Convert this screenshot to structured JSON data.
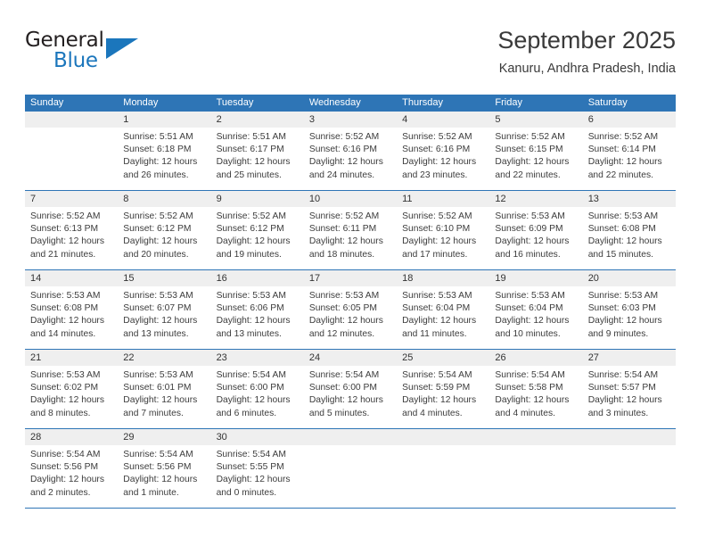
{
  "brand": {
    "word1": "General",
    "word2": "Blue",
    "accent_color": "#1b76bc"
  },
  "header": {
    "title": "September 2025",
    "subtitle": "Kanuru, Andhra Pradesh, India"
  },
  "theme": {
    "header_blue": "#2e75b6",
    "daynum_gray": "#efefef",
    "text": "#3c3c3c"
  },
  "weekdays": [
    "Sunday",
    "Monday",
    "Tuesday",
    "Wednesday",
    "Thursday",
    "Friday",
    "Saturday"
  ],
  "weeks": [
    [
      {
        "day": "",
        "lines": []
      },
      {
        "day": "1",
        "lines": [
          "Sunrise: 5:51 AM",
          "Sunset: 6:18 PM",
          "Daylight: 12 hours",
          "and 26 minutes."
        ]
      },
      {
        "day": "2",
        "lines": [
          "Sunrise: 5:51 AM",
          "Sunset: 6:17 PM",
          "Daylight: 12 hours",
          "and 25 minutes."
        ]
      },
      {
        "day": "3",
        "lines": [
          "Sunrise: 5:52 AM",
          "Sunset: 6:16 PM",
          "Daylight: 12 hours",
          "and 24 minutes."
        ]
      },
      {
        "day": "4",
        "lines": [
          "Sunrise: 5:52 AM",
          "Sunset: 6:16 PM",
          "Daylight: 12 hours",
          "and 23 minutes."
        ]
      },
      {
        "day": "5",
        "lines": [
          "Sunrise: 5:52 AM",
          "Sunset: 6:15 PM",
          "Daylight: 12 hours",
          "and 22 minutes."
        ]
      },
      {
        "day": "6",
        "lines": [
          "Sunrise: 5:52 AM",
          "Sunset: 6:14 PM",
          "Daylight: 12 hours",
          "and 22 minutes."
        ]
      }
    ],
    [
      {
        "day": "7",
        "lines": [
          "Sunrise: 5:52 AM",
          "Sunset: 6:13 PM",
          "Daylight: 12 hours",
          "and 21 minutes."
        ]
      },
      {
        "day": "8",
        "lines": [
          "Sunrise: 5:52 AM",
          "Sunset: 6:12 PM",
          "Daylight: 12 hours",
          "and 20 minutes."
        ]
      },
      {
        "day": "9",
        "lines": [
          "Sunrise: 5:52 AM",
          "Sunset: 6:12 PM",
          "Daylight: 12 hours",
          "and 19 minutes."
        ]
      },
      {
        "day": "10",
        "lines": [
          "Sunrise: 5:52 AM",
          "Sunset: 6:11 PM",
          "Daylight: 12 hours",
          "and 18 minutes."
        ]
      },
      {
        "day": "11",
        "lines": [
          "Sunrise: 5:52 AM",
          "Sunset: 6:10 PM",
          "Daylight: 12 hours",
          "and 17 minutes."
        ]
      },
      {
        "day": "12",
        "lines": [
          "Sunrise: 5:53 AM",
          "Sunset: 6:09 PM",
          "Daylight: 12 hours",
          "and 16 minutes."
        ]
      },
      {
        "day": "13",
        "lines": [
          "Sunrise: 5:53 AM",
          "Sunset: 6:08 PM",
          "Daylight: 12 hours",
          "and 15 minutes."
        ]
      }
    ],
    [
      {
        "day": "14",
        "lines": [
          "Sunrise: 5:53 AM",
          "Sunset: 6:08 PM",
          "Daylight: 12 hours",
          "and 14 minutes."
        ]
      },
      {
        "day": "15",
        "lines": [
          "Sunrise: 5:53 AM",
          "Sunset: 6:07 PM",
          "Daylight: 12 hours",
          "and 13 minutes."
        ]
      },
      {
        "day": "16",
        "lines": [
          "Sunrise: 5:53 AM",
          "Sunset: 6:06 PM",
          "Daylight: 12 hours",
          "and 13 minutes."
        ]
      },
      {
        "day": "17",
        "lines": [
          "Sunrise: 5:53 AM",
          "Sunset: 6:05 PM",
          "Daylight: 12 hours",
          "and 12 minutes."
        ]
      },
      {
        "day": "18",
        "lines": [
          "Sunrise: 5:53 AM",
          "Sunset: 6:04 PM",
          "Daylight: 12 hours",
          "and 11 minutes."
        ]
      },
      {
        "day": "19",
        "lines": [
          "Sunrise: 5:53 AM",
          "Sunset: 6:04 PM",
          "Daylight: 12 hours",
          "and 10 minutes."
        ]
      },
      {
        "day": "20",
        "lines": [
          "Sunrise: 5:53 AM",
          "Sunset: 6:03 PM",
          "Daylight: 12 hours",
          "and 9 minutes."
        ]
      }
    ],
    [
      {
        "day": "21",
        "lines": [
          "Sunrise: 5:53 AM",
          "Sunset: 6:02 PM",
          "Daylight: 12 hours",
          "and 8 minutes."
        ]
      },
      {
        "day": "22",
        "lines": [
          "Sunrise: 5:53 AM",
          "Sunset: 6:01 PM",
          "Daylight: 12 hours",
          "and 7 minutes."
        ]
      },
      {
        "day": "23",
        "lines": [
          "Sunrise: 5:54 AM",
          "Sunset: 6:00 PM",
          "Daylight: 12 hours",
          "and 6 minutes."
        ]
      },
      {
        "day": "24",
        "lines": [
          "Sunrise: 5:54 AM",
          "Sunset: 6:00 PM",
          "Daylight: 12 hours",
          "and 5 minutes."
        ]
      },
      {
        "day": "25",
        "lines": [
          "Sunrise: 5:54 AM",
          "Sunset: 5:59 PM",
          "Daylight: 12 hours",
          "and 4 minutes."
        ]
      },
      {
        "day": "26",
        "lines": [
          "Sunrise: 5:54 AM",
          "Sunset: 5:58 PM",
          "Daylight: 12 hours",
          "and 4 minutes."
        ]
      },
      {
        "day": "27",
        "lines": [
          "Sunrise: 5:54 AM",
          "Sunset: 5:57 PM",
          "Daylight: 12 hours",
          "and 3 minutes."
        ]
      }
    ],
    [
      {
        "day": "28",
        "lines": [
          "Sunrise: 5:54 AM",
          "Sunset: 5:56 PM",
          "Daylight: 12 hours",
          "and 2 minutes."
        ]
      },
      {
        "day": "29",
        "lines": [
          "Sunrise: 5:54 AM",
          "Sunset: 5:56 PM",
          "Daylight: 12 hours",
          "and 1 minute."
        ]
      },
      {
        "day": "30",
        "lines": [
          "Sunrise: 5:54 AM",
          "Sunset: 5:55 PM",
          "Daylight: 12 hours",
          "and 0 minutes."
        ]
      },
      {
        "day": "",
        "lines": []
      },
      {
        "day": "",
        "lines": []
      },
      {
        "day": "",
        "lines": []
      },
      {
        "day": "",
        "lines": []
      }
    ]
  ]
}
